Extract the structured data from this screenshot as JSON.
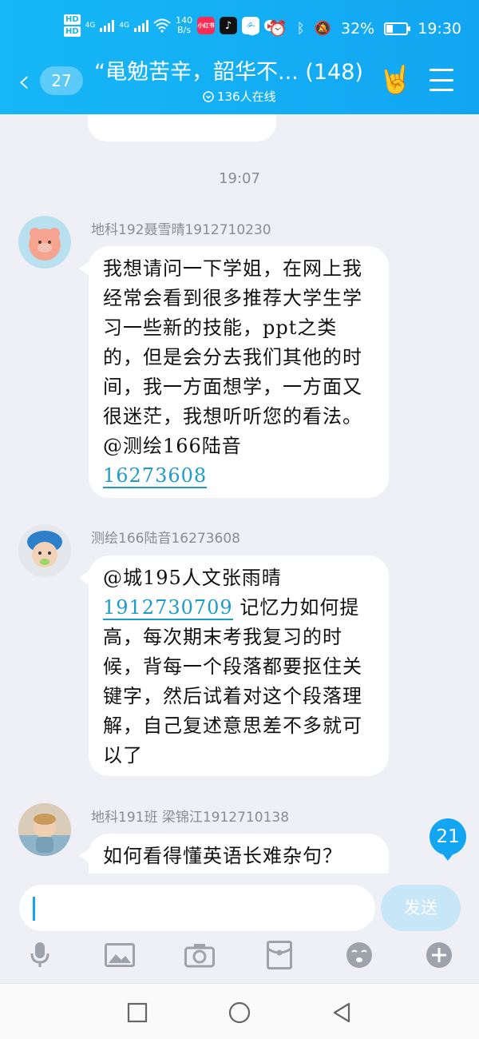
{
  "status_bar": {
    "hd1": "HD",
    "hd2": "HD",
    "net1": "4G",
    "net2": "4G",
    "speed_value": "140",
    "speed_unit": "B/s",
    "app1": "小红书",
    "battery": "32%",
    "time": "19:30"
  },
  "header": {
    "back_count": "27",
    "title": "“黾勉苦辛，韶华不...",
    "member_count": "(148)",
    "online": "136人在线"
  },
  "chat": {
    "time_divider": "19:07",
    "messages": [
      {
        "sender": "地科192聂雪晴1912710230",
        "text": "我想请问一下学姐，在网上我经常会看到很多推荐大学生学习一些新的技能，ppt之类的，但是会分去我们其他的时间，我一方面想学，一方面又很迷茫，我想听听您的看法。@测绘166陆音",
        "mention": "16273608"
      },
      {
        "sender": "测绘166陆音16273608",
        "text_prefix": "@城195人文张雨晴",
        "mention": "1912730709",
        "text": "记忆力如何提高，每次期末考我复习的时候，背每一个段落都要抠住关键字，然后试着对这个段落理解，自己复述意思差不多就可以了"
      },
      {
        "sender": "地科191班 梁锦江1912710138",
        "text": "如何看得懂英语长难杂句？"
      }
    ],
    "unread_count": "21"
  },
  "input": {
    "placeholder": "",
    "send_label": "发送"
  },
  "colors": {
    "accent": "#12a6f2",
    "bubble": "#ffffff",
    "background": "#eef0f5",
    "mention": "#1f9bc8"
  }
}
